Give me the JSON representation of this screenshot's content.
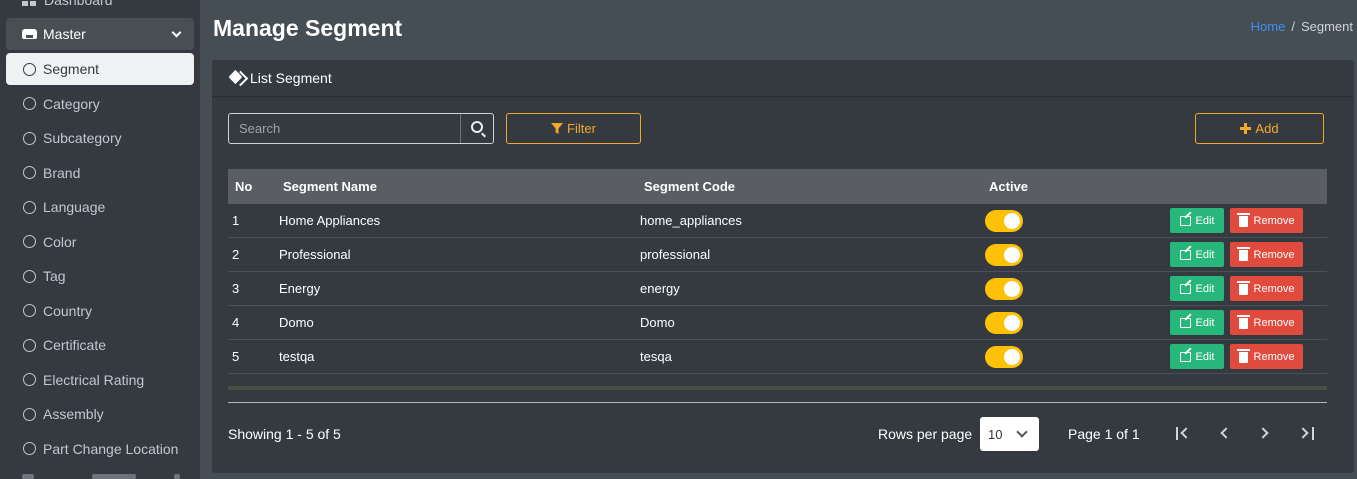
{
  "sidebar": {
    "top_partial_label": "Dashboard",
    "master_label": "Master",
    "items": [
      {
        "label": "Segment",
        "active": true
      },
      {
        "label": "Category"
      },
      {
        "label": "Subcategory"
      },
      {
        "label": "Brand"
      },
      {
        "label": "Language"
      },
      {
        "label": "Color"
      },
      {
        "label": "Tag"
      },
      {
        "label": "Country"
      },
      {
        "label": "Certificate"
      },
      {
        "label": "Electrical Rating"
      },
      {
        "label": "Assembly"
      },
      {
        "label": "Part Change Location"
      }
    ]
  },
  "header": {
    "title": "Manage Segment",
    "breadcrumb_home": "Home",
    "breadcrumb_sep": "/",
    "breadcrumb_current": "Segment"
  },
  "card": {
    "title": "List Segment",
    "search_placeholder": "Search",
    "filter_label": "Filter",
    "add_label": "Add"
  },
  "table": {
    "columns": [
      "No",
      "Segment Name",
      "Segment Code",
      "Active"
    ],
    "rows": [
      {
        "no": "1",
        "name": "Home Appliances",
        "code": "home_appliances",
        "active": true
      },
      {
        "no": "2",
        "name": "Professional",
        "code": "professional",
        "active": true
      },
      {
        "no": "3",
        "name": "Energy",
        "code": "energy",
        "active": true
      },
      {
        "no": "4",
        "name": "Domo",
        "code": "Domo",
        "active": true
      },
      {
        "no": "5",
        "name": "testqa",
        "code": "tesqa",
        "active": true
      }
    ],
    "edit_label": "Edit",
    "remove_label": "Remove"
  },
  "footer": {
    "showing": "Showing 1 - 5 of 5",
    "rows_per_page_label": "Rows per page",
    "rows_per_page_value": "10",
    "page_label": "Page 1 of 1"
  },
  "colors": {
    "accent": "#f2a92a",
    "toggle_on": "#ffc107",
    "edit": "#28b77a",
    "remove": "#e14b3e",
    "link": "#3f8ff0"
  }
}
